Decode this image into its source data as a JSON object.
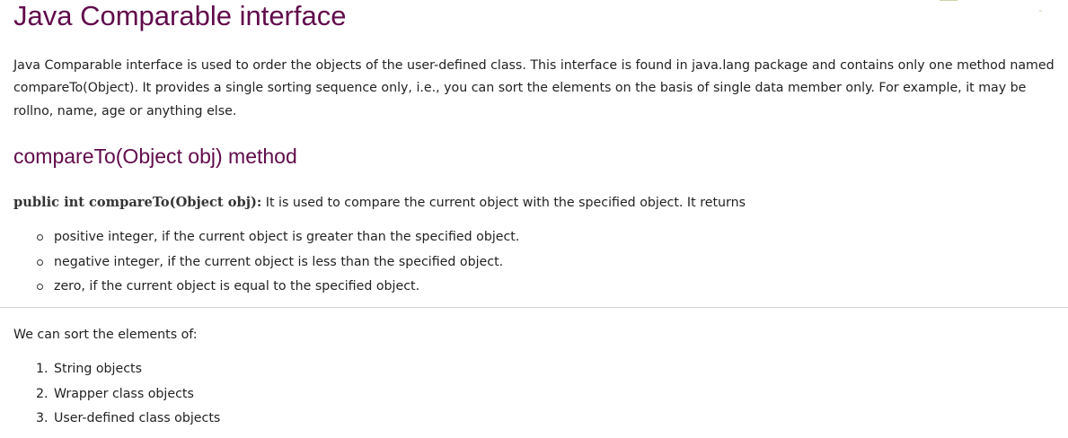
{
  "article": {
    "title": "Java Comparable interface",
    "intro": "Java Comparable interface is used to order the objects of the user-defined class. This interface is found in java.lang package and contains only one method named compareTo(Object). It provides a single sorting sequence only, i.e., you can sort the elements on the basis of single data member only. For example, it may be rollno, name, age or anything else.",
    "method_heading": "compareTo(Object obj) method",
    "method_signature": "public int compareTo(Object obj):",
    "method_description": " It is used to compare the current object with the specified object. It returns",
    "returns": [
      "positive integer, if the current object is greater than the specified object.",
      "negative integer, if the current object is less than the specified object.",
      "zero, if the current object is equal to the specified object."
    ],
    "sort_intro": "We can sort the elements of:",
    "sortable": [
      {
        "num": "1.",
        "label": "String objects"
      },
      {
        "num": "2.",
        "label": "Wrapper class objects"
      },
      {
        "num": "3.",
        "label": "User-defined class objects"
      }
    ]
  },
  "colors": {
    "heading": "#610b4b",
    "text": "#222222",
    "divider": "#d4d4d4"
  }
}
